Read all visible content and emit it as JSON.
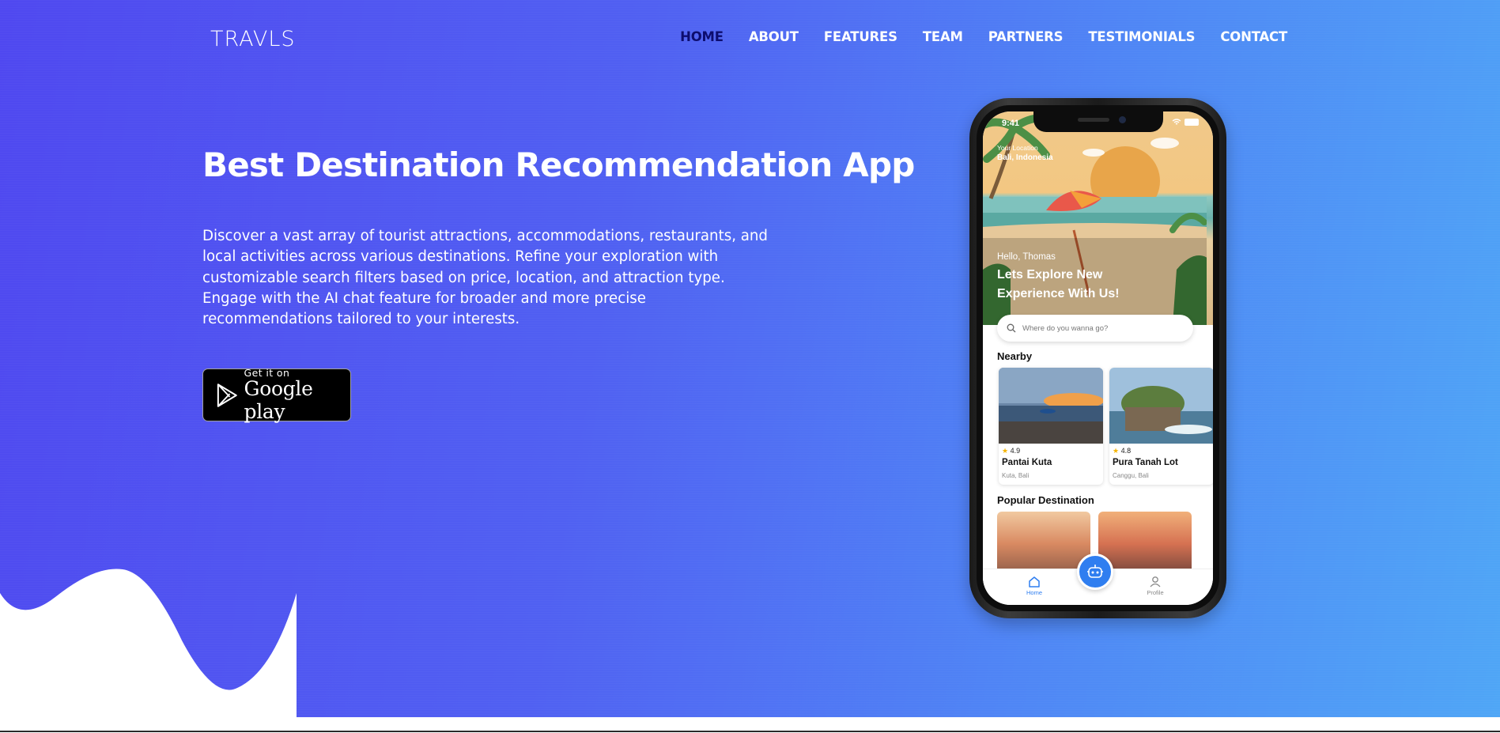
{
  "brand": {
    "logo_text": "TRAVLS"
  },
  "nav": {
    "items": [
      {
        "label": "HOME",
        "active": true
      },
      {
        "label": "ABOUT"
      },
      {
        "label": "FEATURES"
      },
      {
        "label": "TEAM"
      },
      {
        "label": "PARTNERS"
      },
      {
        "label": "TESTIMONIALS"
      },
      {
        "label": "CONTACT"
      }
    ]
  },
  "hero": {
    "title": "Best Destination Recommendation App",
    "description": "Discover a vast array of tourist attractions, accommodations, restaurants, and local activities across various destinations. Refine your exploration with customizable search filters based on price, location, and attraction type. Engage with the AI chat feature for broader and more precise recommendations tailored to your interests.",
    "store_button": {
      "small": "Get it on",
      "big": "Google play"
    }
  },
  "phone": {
    "status_time": "9:41",
    "location_label": "Your Location",
    "location_value": "Bali, Indonesia",
    "greeting": "Hello, Thomas",
    "headline": "Lets Explore New Experience With Us!",
    "search_placeholder": "Where do you wanna go?",
    "nearby_title": "Nearby",
    "nearby": [
      {
        "rating": "4.9",
        "name": "Pantai Kuta",
        "place": "Kuta, Bali"
      },
      {
        "rating": "4.8",
        "name": "Pura Tanah Lot",
        "place": "Canggu, Bali"
      }
    ],
    "popular_title": "Popular Destination",
    "tabs": {
      "home": "Home",
      "profile": "Profile"
    }
  },
  "colors": {
    "gradient_start": "#4f48f0",
    "gradient_end": "#4fa6f6",
    "nav_active": "#0d0d6e",
    "app_accent": "#2f7ef0"
  }
}
